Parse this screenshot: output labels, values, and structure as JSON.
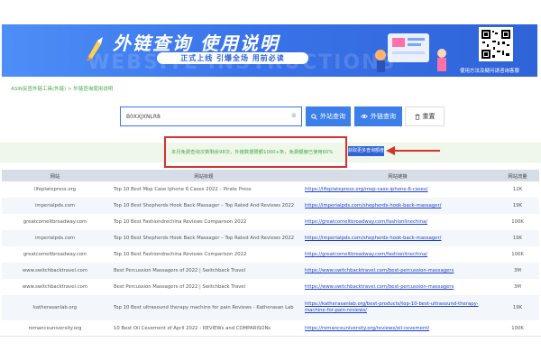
{
  "banner": {
    "title": "外链查询 使用说明",
    "watermark": "WEBSITE INSTRUCTIONS",
    "slogan": "正式上线 引爆全场 用前必读",
    "qr_caption": "使用方法及疑问请咨询客服"
  },
  "breadcrumb": "ASIN反查外链工具(外链) > 外链查询使用说明",
  "search": {
    "value": "B0XXJXNLR8",
    "clear_glyph": "⊗",
    "external_label": "外站查询",
    "outbound_label": "外链查询",
    "reset_label": "重置"
  },
  "notice": {
    "text": "本月免费查询次数剩余98次，外链数据限额1000+条，免费额度已使用60%",
    "link_label": "获取更多查询额度"
  },
  "table": {
    "headers": [
      "网站",
      "网站标题",
      "网站链接",
      "网站流量"
    ],
    "rows": [
      {
        "site": "lifeplatepress.org",
        "title": "Top 10 Best Mop Case Iphone 6 Cases 2022 – Pirate Press",
        "url": "https://lifeplatepress.org/mop-case-iphone-6-cases/",
        "traffic": "12K"
      },
      {
        "site": "imperialpds.com",
        "title": "Top 10 Best Shepherds Hook Back Massager – Top Rated And Reviews 2022",
        "url": "https://imperialpds.com/shepherds-hook-back-massager/",
        "traffic": "19K"
      },
      {
        "site": "greatcomeltbroadway.com",
        "title": "Top 10 Best Fashiondrechina Reviews Comparison 2022",
        "url": "https://greatcomeltbroadway.com/fashionlinechina/",
        "traffic": "100K"
      },
      {
        "site": "imperialpds.com",
        "title": "Top 10 Best Shepherds Hook Back Massager – Top Rated And Reviews 2022",
        "url": "https://imperialpds.com/shepherds-hook-back-massager/",
        "traffic": "19K"
      },
      {
        "site": "greatcomeltbroadway.com",
        "title": "Top 10 Best Fashiondrechina Reviews Comparison 2022",
        "url": "https://greatcomeltbroadway.com/fashionlinechina/",
        "traffic": "100K"
      },
      {
        "site": "www.switchbacktravel.com",
        "title": "Best Percussion Massagers of 2022 | Switchback Travel",
        "url": "https://www.switchbacktravel.com/best-percussion-massagers",
        "traffic": "3M"
      },
      {
        "site": "www.switchbacktravel.com",
        "title": "Best Percussion Massagers of 2022 | Switchback Travel",
        "url": "https://www.switchbacktravel.com/best-percussion-massagers",
        "traffic": "3M"
      },
      {
        "site": "katherasanlab.org",
        "title": "Top 10 Best ultrasound therapy machine for pain Reviews - Katherasan Lab",
        "url": "https://katherasanlab.org/best-products/top-10-best-ultrasound-therapy-machine-for-pain-reviews/",
        "traffic": "19K"
      },
      {
        "site": "romanceuniversity.org",
        "title": "10 Best Oil Cevement of April 2022 - REVIEWs and COMPARISONs",
        "url": "https://romanceuniversity.org/reviews/oil-cevement/",
        "traffic": "100K"
      }
    ]
  },
  "colors": {
    "banner": "#3a74ea",
    "button": "#3d7fe8",
    "highlight_box": "#d9312b",
    "notice_text": "#4aa84a",
    "link": "#1a3fd0"
  }
}
